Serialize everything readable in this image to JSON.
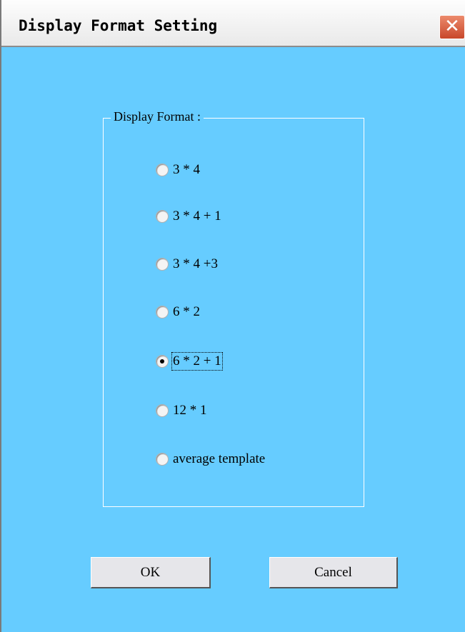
{
  "window": {
    "title": "Display Format Setting",
    "close_glyph": "✕",
    "background_color": "#66ccff"
  },
  "group": {
    "label": "Display Format :"
  },
  "options": [
    {
      "label": "3 * 4",
      "selected": false
    },
    {
      "label": "3 * 4 + 1",
      "selected": false
    },
    {
      "label": "3 * 4 +3",
      "selected": false
    },
    {
      "label": "6 * 2",
      "selected": false
    },
    {
      "label": "6 * 2 + 1",
      "selected": true
    },
    {
      "label": "12 * 1",
      "selected": false
    },
    {
      "label": "average template",
      "selected": false
    }
  ],
  "buttons": {
    "ok_label": "OK",
    "cancel_label": "Cancel"
  }
}
